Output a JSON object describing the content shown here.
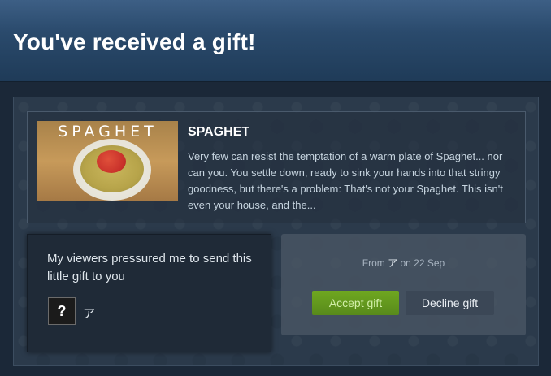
{
  "header": {
    "title": "You've received a gift!"
  },
  "game": {
    "capsule_text": "SPAGHET",
    "title": "SPAGHET",
    "description": "Very few can resist the temptation of a warm plate of Spaghet... nor can you. You settle down, ready to sink your hands into that stringy goodness, but there's a problem: That's not your Spaghet. This isn't even your house, and the..."
  },
  "message": {
    "text": "My viewers pressured me to send this little gift to you",
    "avatar_glyph": "?",
    "sender": "ア"
  },
  "actions": {
    "from_prefix": "From",
    "from_name": "ア",
    "date_text": "on 22 Sep",
    "accept_label": "Accept gift",
    "decline_label": "Decline gift"
  },
  "colors": {
    "accept": "#6fa720",
    "background": "#1b2838",
    "header": "#2a4a6c"
  }
}
